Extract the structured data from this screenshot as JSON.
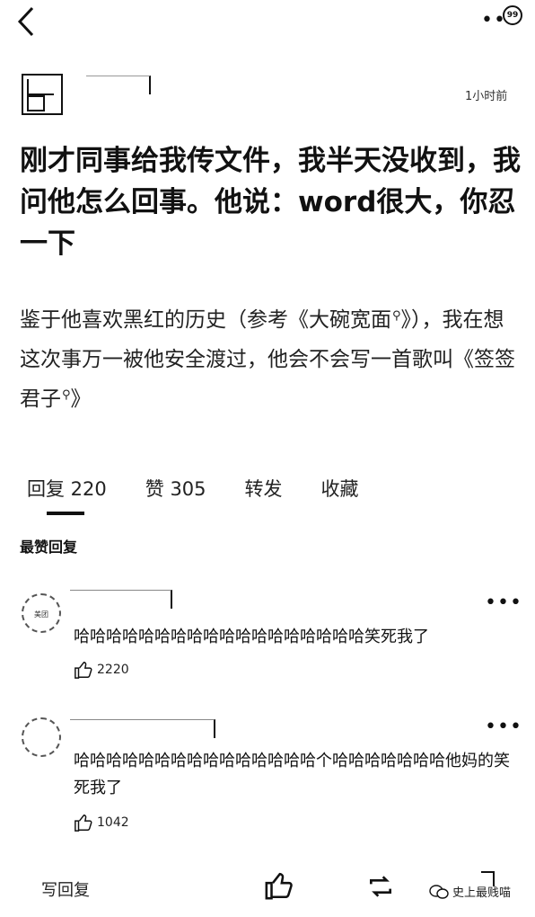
{
  "top_bar": {
    "badge_count": "99"
  },
  "post": {
    "time": "1小时前",
    "title": "刚才同事给我传文件，我半天没收到，我问他怎么回事。他说：word很大，你忍一下",
    "body_part1": "鉴于他喜欢黑红的历史（参考《大碗宽面",
    "body_part2": "》），我在想这次事万一被他安全渡过，他会不会写一首歌叫《签签君子",
    "body_part3": "》"
  },
  "tabs": [
    {
      "label": "回复 220"
    },
    {
      "label": "赞 305"
    },
    {
      "label": "转发"
    },
    {
      "label": "收藏"
    }
  ],
  "section_label": "最赞回复",
  "comments": [
    {
      "text": "哈哈哈哈哈哈哈哈哈哈哈哈哈哈哈哈哈哈笑死我了",
      "likes": "2220"
    },
    {
      "text": "哈哈哈哈哈哈哈哈哈哈哈哈哈哈哈个哈哈哈哈哈哈哈他妈的笑死我了",
      "likes": "1042"
    }
  ],
  "bottom_bar": {
    "reply_label": "写回复",
    "watermark": "史上最贱喵"
  }
}
